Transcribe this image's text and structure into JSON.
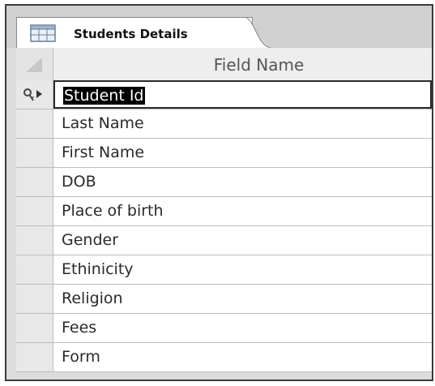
{
  "tab": {
    "title": "Students Details",
    "icon": "table-icon"
  },
  "grid": {
    "column_header": "Field Name",
    "primary_key_icon": "key-icon",
    "current_row_icon": "row-pointer-icon",
    "fields": [
      {
        "name": "Student Id",
        "primary_key": true,
        "selected": true
      },
      {
        "name": "Last Name"
      },
      {
        "name": "First Name"
      },
      {
        "name": "DOB"
      },
      {
        "name": "Place of birth"
      },
      {
        "name": "Gender"
      },
      {
        "name": "Ethinicity"
      },
      {
        "name": "Religion"
      },
      {
        "name": "Fees"
      },
      {
        "name": "Form"
      }
    ]
  }
}
